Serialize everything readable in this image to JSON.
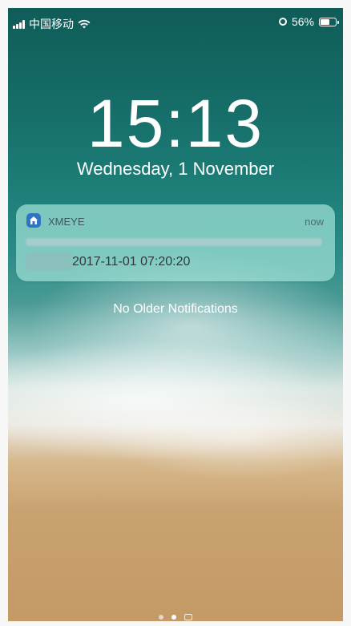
{
  "status_bar": {
    "carrier": "中国移动",
    "battery": "56%"
  },
  "lock_screen": {
    "time": "15:13",
    "date": "Wednesday, 1 November"
  },
  "notification": {
    "app_name": "XMEYE",
    "time": "now",
    "message": "2017-11-01 07:20:20",
    "app_icon": "home-icon"
  },
  "footer": {
    "no_older": "No Older Notifications"
  },
  "page_indicator": {
    "count": 3,
    "active_index": 1,
    "last_icon": "camera-icon"
  }
}
